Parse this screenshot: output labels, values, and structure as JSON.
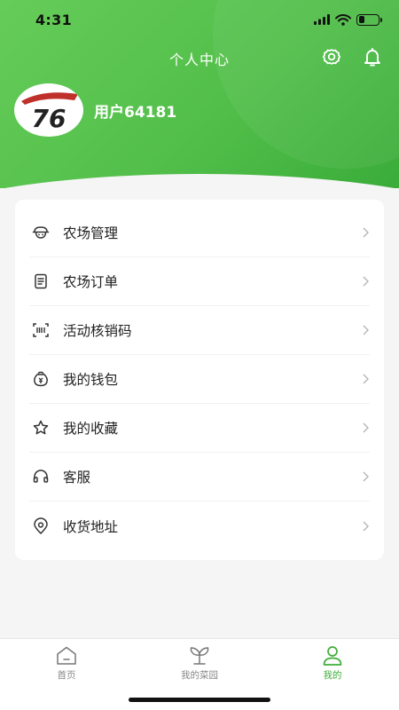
{
  "status_bar": {
    "time": "4:31"
  },
  "header": {
    "title": "个人中心",
    "settings_icon": "gear-icon",
    "notification_icon": "bell-icon",
    "bg_color_start": "#66cc59",
    "bg_color_end": "#3aac39"
  },
  "profile": {
    "avatar_text": "76",
    "username": "用户64181"
  },
  "menu": {
    "items": [
      {
        "label": "农场管理",
        "icon": "farm-hat-icon"
      },
      {
        "label": "农场订单",
        "icon": "order-document-icon"
      },
      {
        "label": "活动核销码",
        "icon": "scan-code-icon"
      },
      {
        "label": "我的钱包",
        "icon": "wallet-icon"
      },
      {
        "label": "我的收藏",
        "icon": "star-icon"
      },
      {
        "label": "客服",
        "icon": "headset-icon"
      },
      {
        "label": "收货地址",
        "icon": "location-icon"
      }
    ]
  },
  "tabbar": {
    "items": [
      {
        "label": "首页",
        "icon": "home-icon",
        "active": false
      },
      {
        "label": "我的菜园",
        "icon": "sprout-icon",
        "active": false
      },
      {
        "label": "我的",
        "icon": "person-icon",
        "active": true
      }
    ],
    "active_color": "#3fae3a"
  }
}
